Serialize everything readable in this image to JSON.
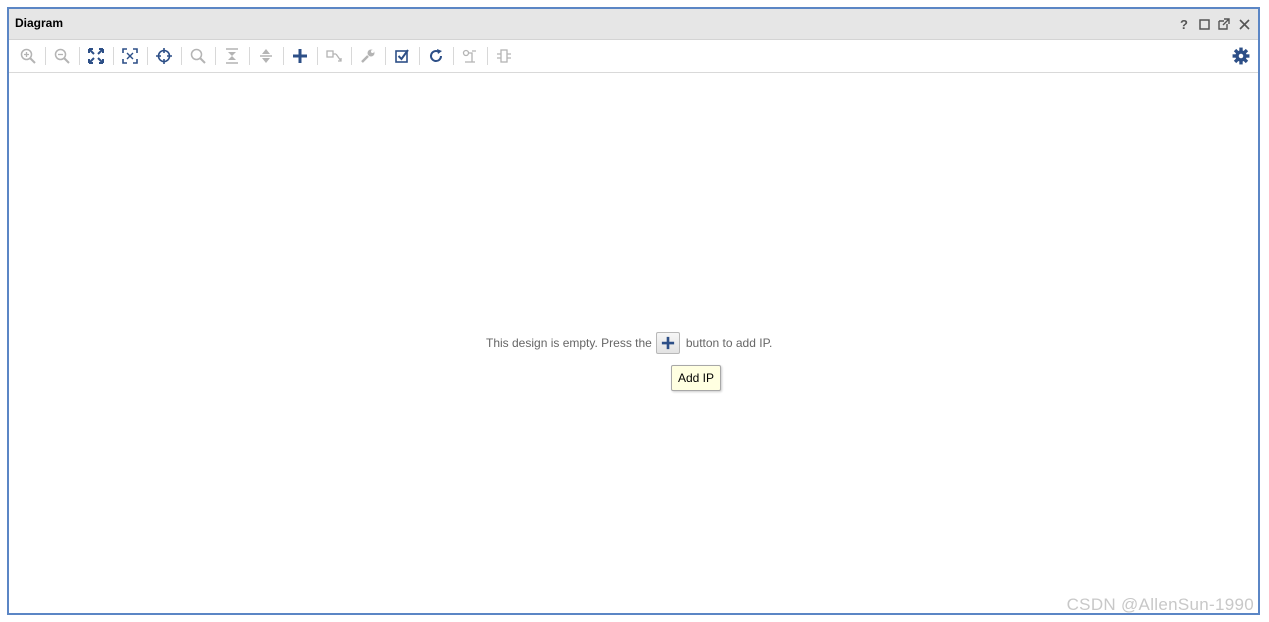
{
  "window": {
    "title": "Diagram",
    "controls": [
      "?",
      "□",
      "⧉",
      "✕"
    ]
  },
  "toolbar": {
    "tools": [
      {
        "icon": "zoom-in-icon",
        "enabled": false
      },
      {
        "icon": "zoom-out-icon",
        "enabled": false
      },
      {
        "icon": "zoom-fit-icon",
        "enabled": true
      },
      {
        "icon": "zoom-selection-icon",
        "enabled": true
      },
      {
        "icon": "autofit-selection-icon",
        "enabled": true
      },
      {
        "icon": "search-icon",
        "enabled": false
      },
      {
        "icon": "collapse-all-icon",
        "enabled": false
      },
      {
        "icon": "expand-all-icon",
        "enabled": false
      },
      {
        "icon": "add-ip-icon",
        "enabled": true
      },
      {
        "icon": "make-connection-icon",
        "enabled": false
      },
      {
        "icon": "wrench-icon",
        "enabled": false
      },
      {
        "icon": "validate-design-icon",
        "enabled": true
      },
      {
        "icon": "regenerate-layout-icon",
        "enabled": true
      },
      {
        "icon": "optimize-routing-icon",
        "enabled": false
      },
      {
        "icon": "ports-icon",
        "enabled": false
      }
    ],
    "settings_icon": "gear-icon"
  },
  "canvas": {
    "message_before": "This design is empty. Press the",
    "message_after": "button to add IP.",
    "tooltip": "Add IP"
  },
  "watermark": "CSDN @AllenSun-1990",
  "colors": {
    "accent": "#2d4f87",
    "disabled": "#b4b4b4",
    "border": "#5b86c5"
  }
}
